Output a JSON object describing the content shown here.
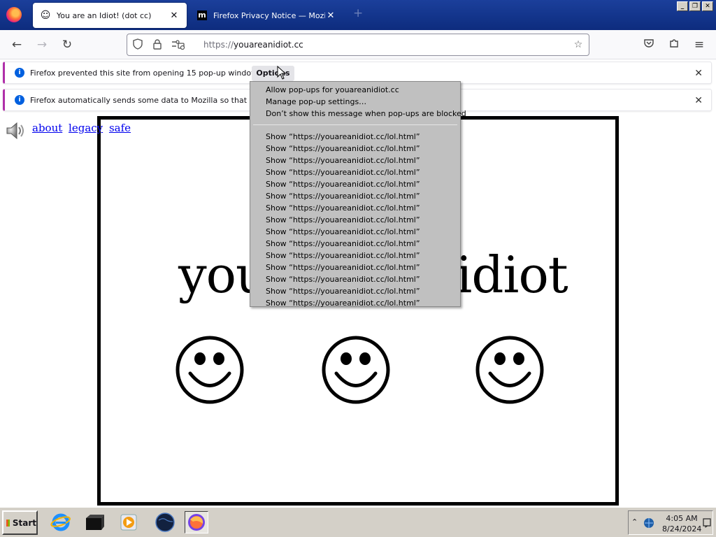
{
  "browser": {
    "tabs": [
      {
        "title": "You are an Idiot! (dot cc)",
        "favicon": "smiley-face-icon",
        "active": true
      },
      {
        "title": "Firefox Privacy Notice — Mozilla",
        "favicon": "mozilla-m-icon",
        "active": false
      }
    ],
    "close_glyph": "✕",
    "new_tab_glyph": "+",
    "url": {
      "scheme": "https://",
      "host": "youareanidiot.cc"
    }
  },
  "notifications": {
    "popup_blocked": {
      "message": "Firefox prevented this site from opening 15 pop-up windows.",
      "options_label": "Options"
    },
    "data_reporting": {
      "message": "Firefox automatically sends some data to Mozilla so that we can im"
    }
  },
  "options_menu": {
    "items": [
      "Allow pop-ups for youareanidiot.cc",
      "Manage pop-up settings…",
      "Don’t show this message when pop-ups are blocked"
    ],
    "popup_items": [
      "Show “https://youareanidiot.cc/lol.html”",
      "Show “https://youareanidiot.cc/lol.html”",
      "Show “https://youareanidiot.cc/lol.html”",
      "Show “https://youareanidiot.cc/lol.html”",
      "Show “https://youareanidiot.cc/lol.html”",
      "Show “https://youareanidiot.cc/lol.html”",
      "Show “https://youareanidiot.cc/lol.html”",
      "Show “https://youareanidiot.cc/lol.html”",
      "Show “https://youareanidiot.cc/lol.html”",
      "Show “https://youareanidiot.cc/lol.html”",
      "Show “https://youareanidiot.cc/lol.html”",
      "Show “https://youareanidiot.cc/lol.html”",
      "Show “https://youareanidiot.cc/lol.html”",
      "Show “https://youareanidiot.cc/lol.html”",
      "Show “https://youareanidiot.cc/lol.html”"
    ]
  },
  "page": {
    "links": [
      "about",
      "legacy",
      "safe"
    ],
    "headline": "you are an idiot",
    "smileys": 3
  },
  "taskbar": {
    "start_label": "Start",
    "time": "4:05 AM",
    "date": "8/24/2024"
  }
}
